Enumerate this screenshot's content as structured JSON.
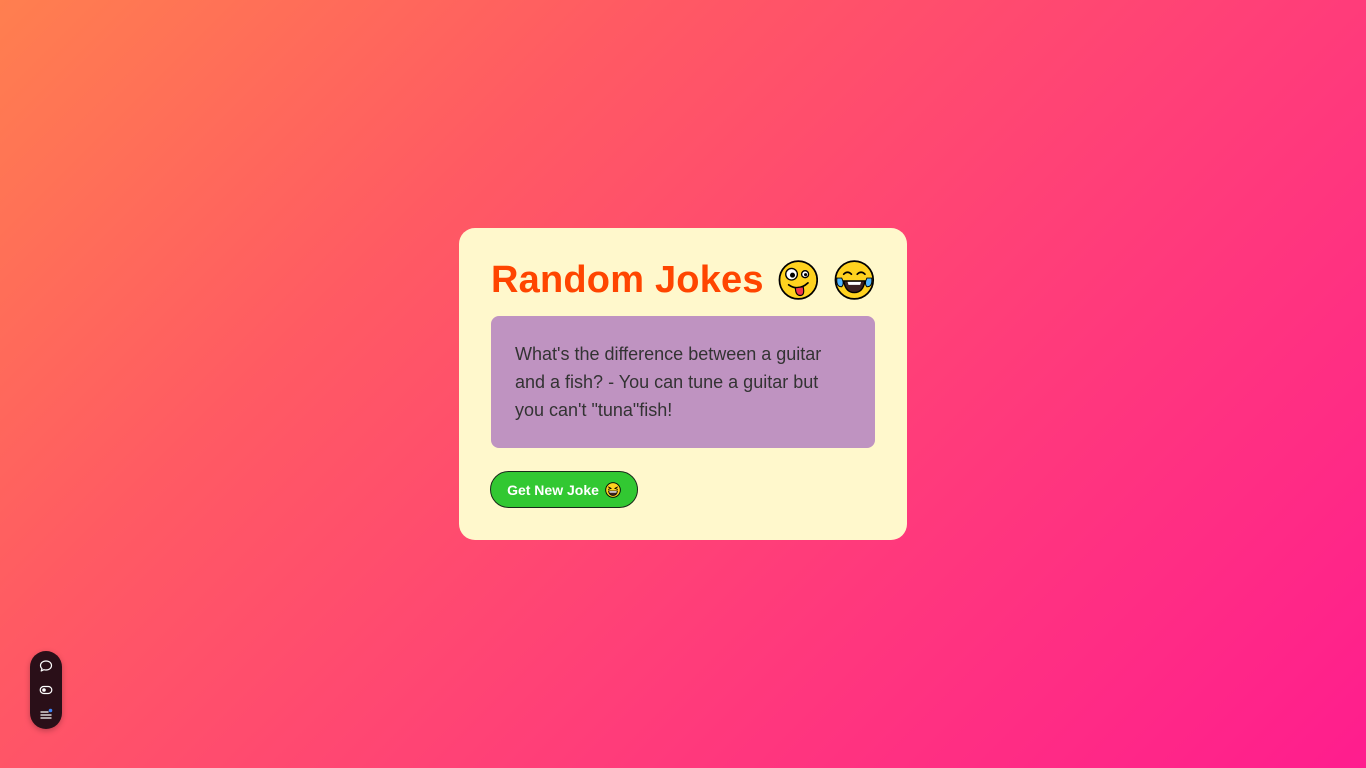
{
  "card": {
    "title": "Random Jokes",
    "title_emojis": [
      "zany-face-icon",
      "tears-of-joy-icon"
    ],
    "joke": "What's the difference between a guitar and a fish? - You can tune a guitar but you can't \"tuna\"fish!",
    "button_label": "Get New Joke",
    "button_emoji": "grinning-squinting-face-icon"
  },
  "dock": {
    "items": [
      "chat-icon",
      "toggle-icon",
      "menu-icon"
    ]
  },
  "colors": {
    "title": "#ff4500",
    "card_background": "#fff8cc",
    "joke_background": "#bf93c1",
    "button_background": "#32c832"
  }
}
